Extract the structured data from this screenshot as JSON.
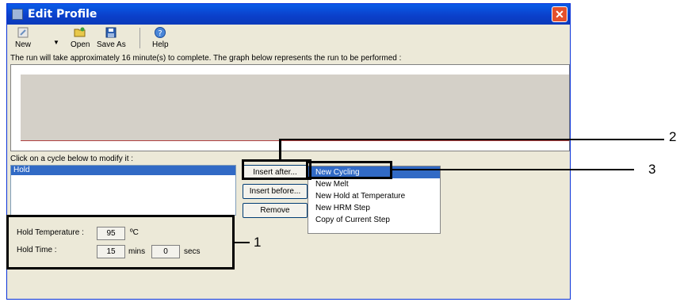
{
  "window": {
    "title": "Edit Profile",
    "close_glyph": "✕"
  },
  "toolbar": {
    "new_label": "New",
    "open_label": "Open",
    "save_as_label": "Save As",
    "help_label": "Help"
  },
  "info_text": "The run will take approximately 16 minute(s) to complete. The graph below represents the run to be performed :",
  "cycle_list": {
    "label": "Click on a cycle below to modify it :",
    "items": [
      "Hold"
    ]
  },
  "buttons": {
    "insert_after": "Insert after...",
    "insert_before": "Insert before...",
    "remove": "Remove"
  },
  "menu": {
    "items": [
      "New Cycling",
      "New Melt",
      "New Hold at Temperature",
      "New HRM Step",
      "Copy of Current Step"
    ]
  },
  "hold": {
    "temperature_label": "Hold Temperature :",
    "temperature_value": "95",
    "temperature_unit": "ºC",
    "time_label": "Hold Time :",
    "minutes_value": "15",
    "minutes_unit": "mins",
    "seconds_value": "0",
    "seconds_unit": "secs"
  },
  "callouts": {
    "one": "1",
    "two": "2",
    "three": "3"
  },
  "colors": {
    "title_bar": "#0b3fc9",
    "selection": "#316ac5",
    "window_bg": "#ece9d8"
  }
}
